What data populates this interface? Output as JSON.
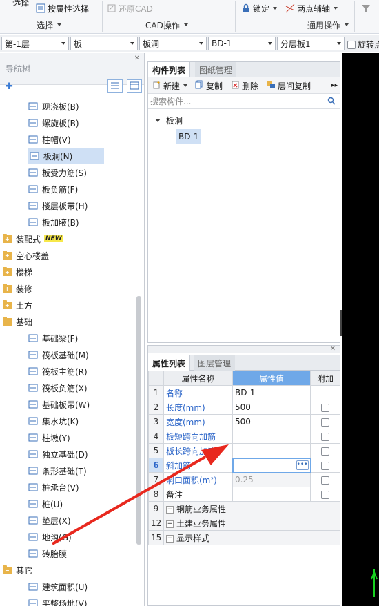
{
  "ribbon": {
    "select_top": "选择",
    "attr_select": "按属性选择",
    "select_group": "选择",
    "restore_cad": "还原CAD",
    "cad_group": "CAD操作",
    "lock": "锁定",
    "two_point_aux": "两点辅轴",
    "common_group": "通用操作"
  },
  "dropdowns": {
    "floor": "第-1层",
    "category": "板",
    "type": "板洞",
    "component": "BD-1",
    "layer": "分层板1",
    "rotate_label": "旋转点"
  },
  "nav": {
    "title": "导航树",
    "items": [
      {
        "label": "现浇板(B)",
        "icon": "cast-slab-icon",
        "kind": "child"
      },
      {
        "label": "螺旋板(B)",
        "icon": "spiral-slab-icon",
        "kind": "child"
      },
      {
        "label": "柱帽(V)",
        "icon": "column-cap-icon",
        "kind": "child"
      },
      {
        "label": "板洞(N)",
        "icon": "slab-opening-icon",
        "kind": "child",
        "selected": true
      },
      {
        "label": "板受力筋(S)",
        "icon": "slab-rebar-icon",
        "kind": "child"
      },
      {
        "label": "板负筋(F)",
        "icon": "slab-negative-rebar-icon",
        "kind": "child"
      },
      {
        "label": "楼层板带(H)",
        "icon": "floor-strip-icon",
        "kind": "child"
      },
      {
        "label": "板加腋(B)",
        "icon": "slab-haunch-icon",
        "kind": "child"
      },
      {
        "label": "装配式",
        "kind": "folder",
        "badge": "NEW"
      },
      {
        "label": "空心楼盖",
        "kind": "folder"
      },
      {
        "label": "楼梯",
        "kind": "folder"
      },
      {
        "label": "装修",
        "kind": "folder"
      },
      {
        "label": "土方",
        "kind": "folder"
      },
      {
        "label": "基础",
        "kind": "folder-open"
      },
      {
        "label": "基础梁(F)",
        "icon": "foundation-beam-icon",
        "kind": "child"
      },
      {
        "label": "筏板基础(M)",
        "icon": "raft-foundation-icon",
        "kind": "child"
      },
      {
        "label": "筏板主筋(R)",
        "icon": "raft-main-rebar-icon",
        "kind": "child"
      },
      {
        "label": "筏板负筋(X)",
        "icon": "raft-negative-rebar-icon",
        "kind": "child"
      },
      {
        "label": "基础板带(W)",
        "icon": "foundation-strip-icon",
        "kind": "child"
      },
      {
        "label": "集水坑(K)",
        "icon": "sump-pit-icon",
        "kind": "child"
      },
      {
        "label": "柱墩(Y)",
        "icon": "column-pier-icon",
        "kind": "child"
      },
      {
        "label": "独立基础(D)",
        "icon": "isolated-footing-icon",
        "kind": "child"
      },
      {
        "label": "条形基础(T)",
        "icon": "strip-footing-icon",
        "kind": "child"
      },
      {
        "label": "桩承台(V)",
        "icon": "pile-cap-icon",
        "kind": "child"
      },
      {
        "label": "桩(U)",
        "icon": "pile-icon",
        "kind": "child"
      },
      {
        "label": "垫层(X)",
        "icon": "cushion-icon",
        "kind": "child"
      },
      {
        "label": "地沟(G)",
        "icon": "trench-icon",
        "kind": "child"
      },
      {
        "label": "砖胎膜",
        "icon": "brick-mold-icon",
        "kind": "child"
      },
      {
        "label": "其它",
        "kind": "folder-open"
      },
      {
        "label": "建筑面积(U)",
        "icon": "building-area-icon",
        "kind": "child"
      },
      {
        "label": "平整场地(V)",
        "icon": "site-leveling-icon",
        "kind": "child"
      }
    ]
  },
  "comp": {
    "tab_active": "构件列表",
    "tab_inactive": "图纸管理",
    "new": "新建",
    "copy": "复制",
    "delete": "删除",
    "floor_copy": "层间复制",
    "search_placeholder": "搜索构件...",
    "group": "板洞",
    "item": "BD-1"
  },
  "prop": {
    "tab_active": "属性列表",
    "tab_inactive": "图层管理",
    "col_name": "属性名称",
    "col_value": "属性值",
    "col_extra": "附加",
    "rows": [
      {
        "num": "1",
        "name": "名称",
        "value": "BD-1",
        "blue": true,
        "check": false
      },
      {
        "num": "2",
        "name": "长度(mm)",
        "value": "500",
        "blue": true,
        "check": true
      },
      {
        "num": "3",
        "name": "宽度(mm)",
        "value": "500",
        "blue": true,
        "check": true
      },
      {
        "num": "4",
        "name": "板短跨向加筋",
        "value": "",
        "blue": true,
        "check": true
      },
      {
        "num": "5",
        "name": "板长跨向加筋",
        "value": "",
        "blue": true,
        "check": true
      },
      {
        "num": "6",
        "name": "斜加筋",
        "value": "",
        "blue": true,
        "check": true,
        "editing": true
      },
      {
        "num": "7",
        "name": "洞口面积(m²)",
        "value": "0.25",
        "blue": true,
        "check": true,
        "grey": true
      },
      {
        "num": "8",
        "name": "备注",
        "value": "",
        "blue": false,
        "check": true
      },
      {
        "num": "9",
        "name": "钢筋业务属性",
        "group": true
      },
      {
        "num": "12",
        "name": "土建业务属性",
        "group": true
      },
      {
        "num": "15",
        "name": "显示样式",
        "group": true
      }
    ]
  },
  "colors": {
    "accent": "#6fa8e8",
    "selected_bg": "#cfe0f5",
    "link_blue": "#2a64c8",
    "arrow_red": "#e8281e"
  }
}
